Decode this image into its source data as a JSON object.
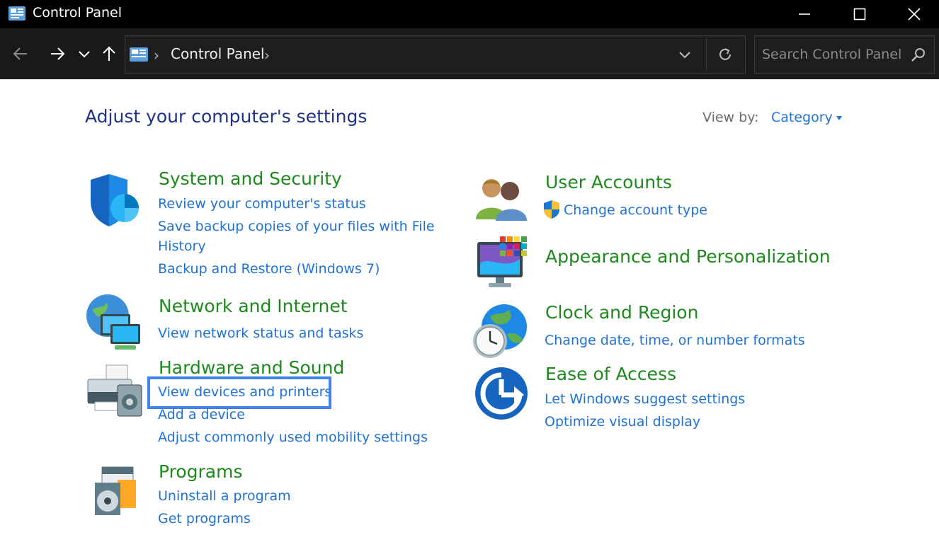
{
  "window": {
    "title": "Control Panel"
  },
  "toolbar": {
    "crumb": "Control Panel",
    "search_placeholder": "Search Control Panel"
  },
  "main": {
    "heading": "Adjust your computer's settings",
    "view_by_label": "View by:",
    "view_by_value": "Category"
  },
  "categories": {
    "system": {
      "title": "System and Security",
      "links": [
        "Review your computer's status",
        "Save backup copies of your files with File",
        "History",
        "Backup and Restore (Windows 7)"
      ]
    },
    "network": {
      "title": "Network and Internet",
      "links": [
        "View network status and tasks"
      ]
    },
    "hardware": {
      "title": "Hardware and Sound",
      "links": [
        "View devices and printers",
        "Add a device",
        "Adjust commonly used mobility settings"
      ]
    },
    "programs": {
      "title": "Programs",
      "links": [
        "Uninstall a program",
        "Get programs"
      ]
    },
    "users": {
      "title": "User Accounts",
      "links": [
        "Change account type"
      ]
    },
    "appearance": {
      "title": "Appearance and Personalization"
    },
    "clock": {
      "title": "Clock and Region",
      "links": [
        "Change date, time, or number formats"
      ]
    },
    "ease": {
      "title": "Ease of Access",
      "links": [
        "Let Windows suggest settings",
        "Optimize visual display"
      ]
    }
  },
  "colors": {
    "heading": "#1e3287",
    "category_title": "#1d8a1d",
    "link": "#1f72d6",
    "highlight": "#3c82f0",
    "titlebar": "#000000",
    "toolbar": "#191919"
  },
  "icons": [
    "control-panel-icon",
    "minimize-icon",
    "maximize-icon",
    "close-icon",
    "back-arrow-icon",
    "forward-arrow-icon",
    "recent-dropdown-icon",
    "up-arrow-icon",
    "refresh-icon",
    "search-icon",
    "shield-icon",
    "network-icon",
    "printer-icon",
    "programs-icon",
    "users-icon",
    "monitor-palette-icon",
    "clock-globe-icon",
    "ease-of-access-icon",
    "uac-shield-icon"
  ]
}
